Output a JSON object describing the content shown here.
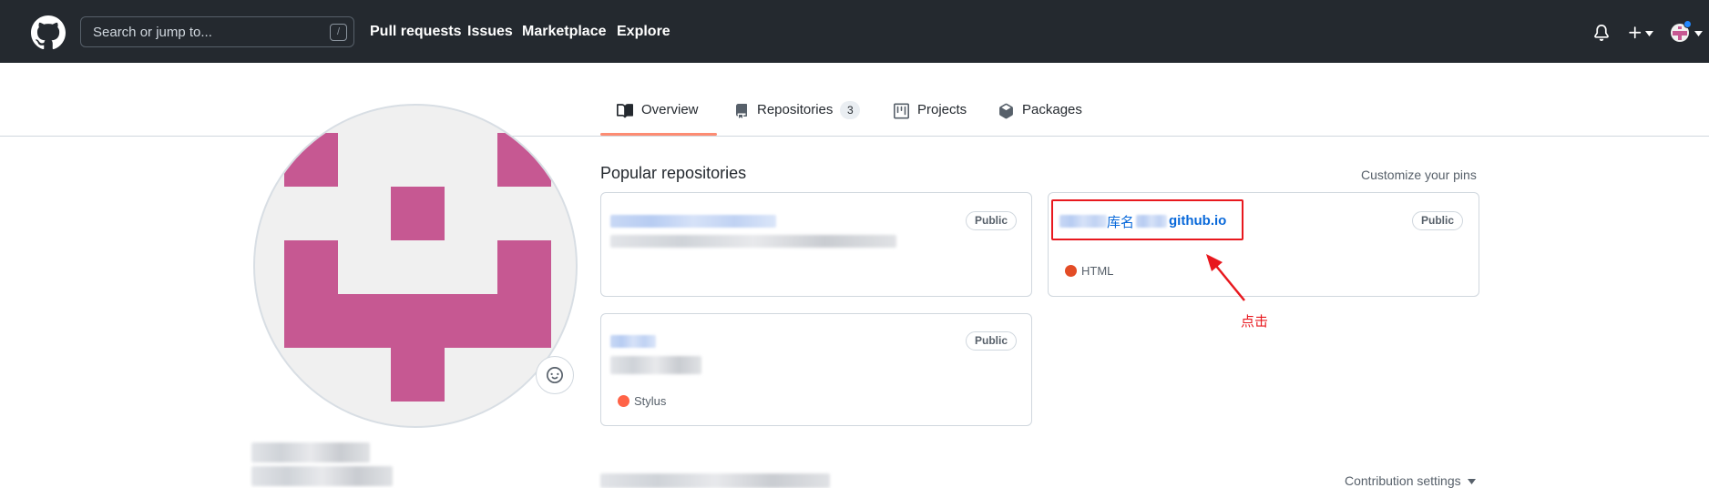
{
  "header": {
    "search_placeholder": "Search or jump to...",
    "search_shortcut": "/",
    "nav": [
      "Pull requests",
      "Issues",
      "Marketplace",
      "Explore"
    ]
  },
  "tabs": [
    {
      "label": "Overview",
      "icon": "book-icon",
      "selected": true
    },
    {
      "label": "Repositories",
      "icon": "repo-icon",
      "count": "3"
    },
    {
      "label": "Projects",
      "icon": "project-icon"
    },
    {
      "label": "Packages",
      "icon": "package-icon"
    }
  ],
  "popular": {
    "title": "Popular repositories",
    "customize": "Customize your pins",
    "repos": [
      {
        "visibility": "Public"
      },
      {
        "name_part1": "库名",
        "name_part2": "github.io",
        "visibility": "Public",
        "language": "HTML",
        "language_color": "#e34c26"
      },
      {
        "visibility": "Public",
        "language": "Stylus",
        "language_color": "#ff6347"
      }
    ]
  },
  "annotation": {
    "text": "点击",
    "color": "#e8181e"
  },
  "contribution": {
    "label": "Contribution settings"
  },
  "colors": {
    "header_bg": "#24292f",
    "tab_underline": "#fd8c73",
    "link": "#0969da",
    "avatar_pink": "#c65892"
  }
}
